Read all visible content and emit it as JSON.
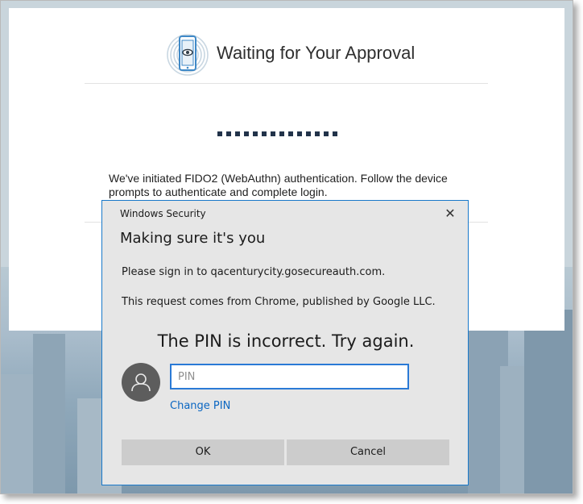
{
  "page": {
    "title": "Waiting for Your Approval",
    "loading_dot_count": 14,
    "message": "We've initiated FIDO2 (WebAuthn) authentication. Follow the device prompts to authenticate and complete login."
  },
  "dialog": {
    "app_title": "Windows Security",
    "close_label": "✕",
    "heading": "Making sure it's you",
    "signin_text": "Please sign in to qacenturycity.gosecureauth.com.",
    "request_text": "This request comes from Chrome, published by Google LLC.",
    "error_text": "The PIN is incorrect. Try again.",
    "pin_placeholder": "PIN",
    "pin_value": "",
    "change_pin_label": "Change PIN",
    "ok_label": "OK",
    "cancel_label": "Cancel"
  },
  "colors": {
    "dialog_border": "#1979ca",
    "link": "#0a66c2",
    "dots": "#22334a"
  },
  "icons": {
    "logo": "phone-fingerprint-eye-icon",
    "avatar": "user-silhouette-icon",
    "close": "close-icon"
  }
}
